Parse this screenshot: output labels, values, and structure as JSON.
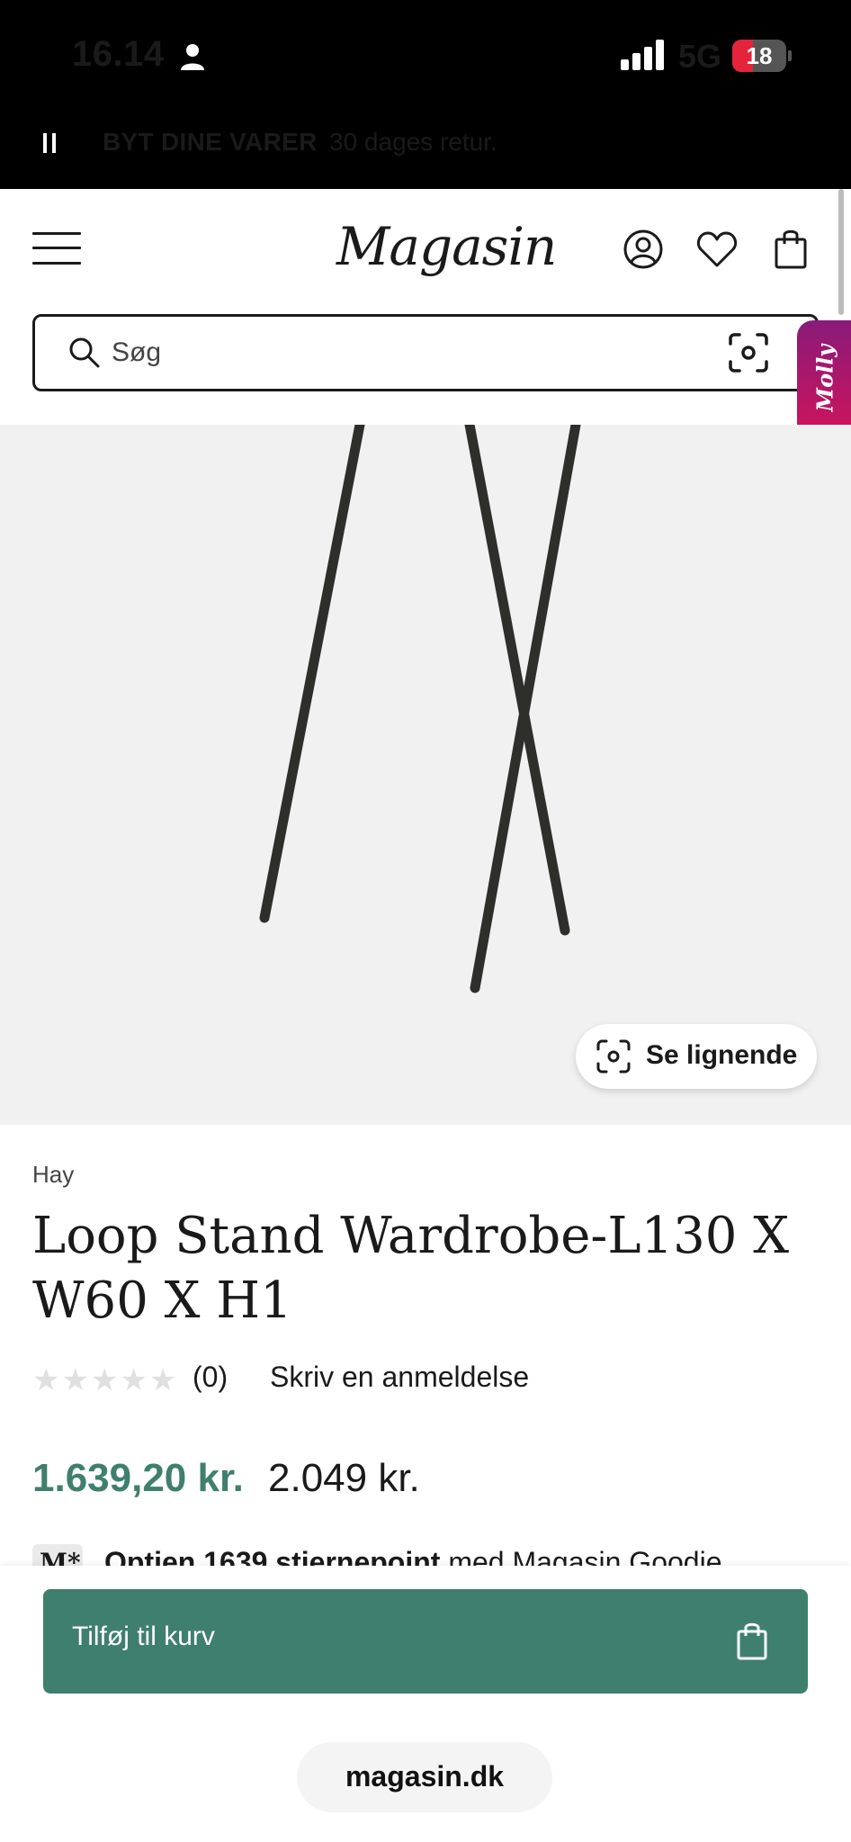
{
  "status_bar": {
    "time": "16.14",
    "network": "5G",
    "battery": "18",
    "battery_level_percent": 18,
    "icons": [
      "person-icon",
      "signal-icon",
      "battery-icon"
    ]
  },
  "promo": {
    "title": "BYT DINE VARER",
    "subtitle": "30 dages retur.",
    "control_icon": "pause-icon"
  },
  "header": {
    "logo": "Magasin",
    "icons": [
      "menu-icon",
      "account-icon",
      "heart-icon",
      "bag-icon"
    ],
    "search_placeholder": "Søg",
    "search_icons": [
      "search-icon",
      "camera-search-icon"
    ],
    "assistant_tab": "Molly"
  },
  "product": {
    "similar_button": "Se lignende",
    "brand": "Hay",
    "title": "Loop Stand Wardrobe-L130 X W60 X H1",
    "rating_stars": "★★★★★",
    "rating_value": 0,
    "review_count": "(0)",
    "write_review": "Skriv en anmeldelse",
    "sale_price": "1.639,20 kr.",
    "original_price": "2.049 kr.",
    "points_badge": "M*",
    "points_bold": "Optjen 1639 stjernepoint",
    "points_rest": " med Magasin Goodie"
  },
  "actions": {
    "add_to_cart": "Tilføj til kurv"
  },
  "browser": {
    "url": "magasin.dk"
  },
  "colors": {
    "accent_green": "#3f7f6e",
    "assistant_gradient_start": "#8a1a7a",
    "assistant_gradient_end": "#d1145a",
    "image_background": "#f1f1f1"
  }
}
